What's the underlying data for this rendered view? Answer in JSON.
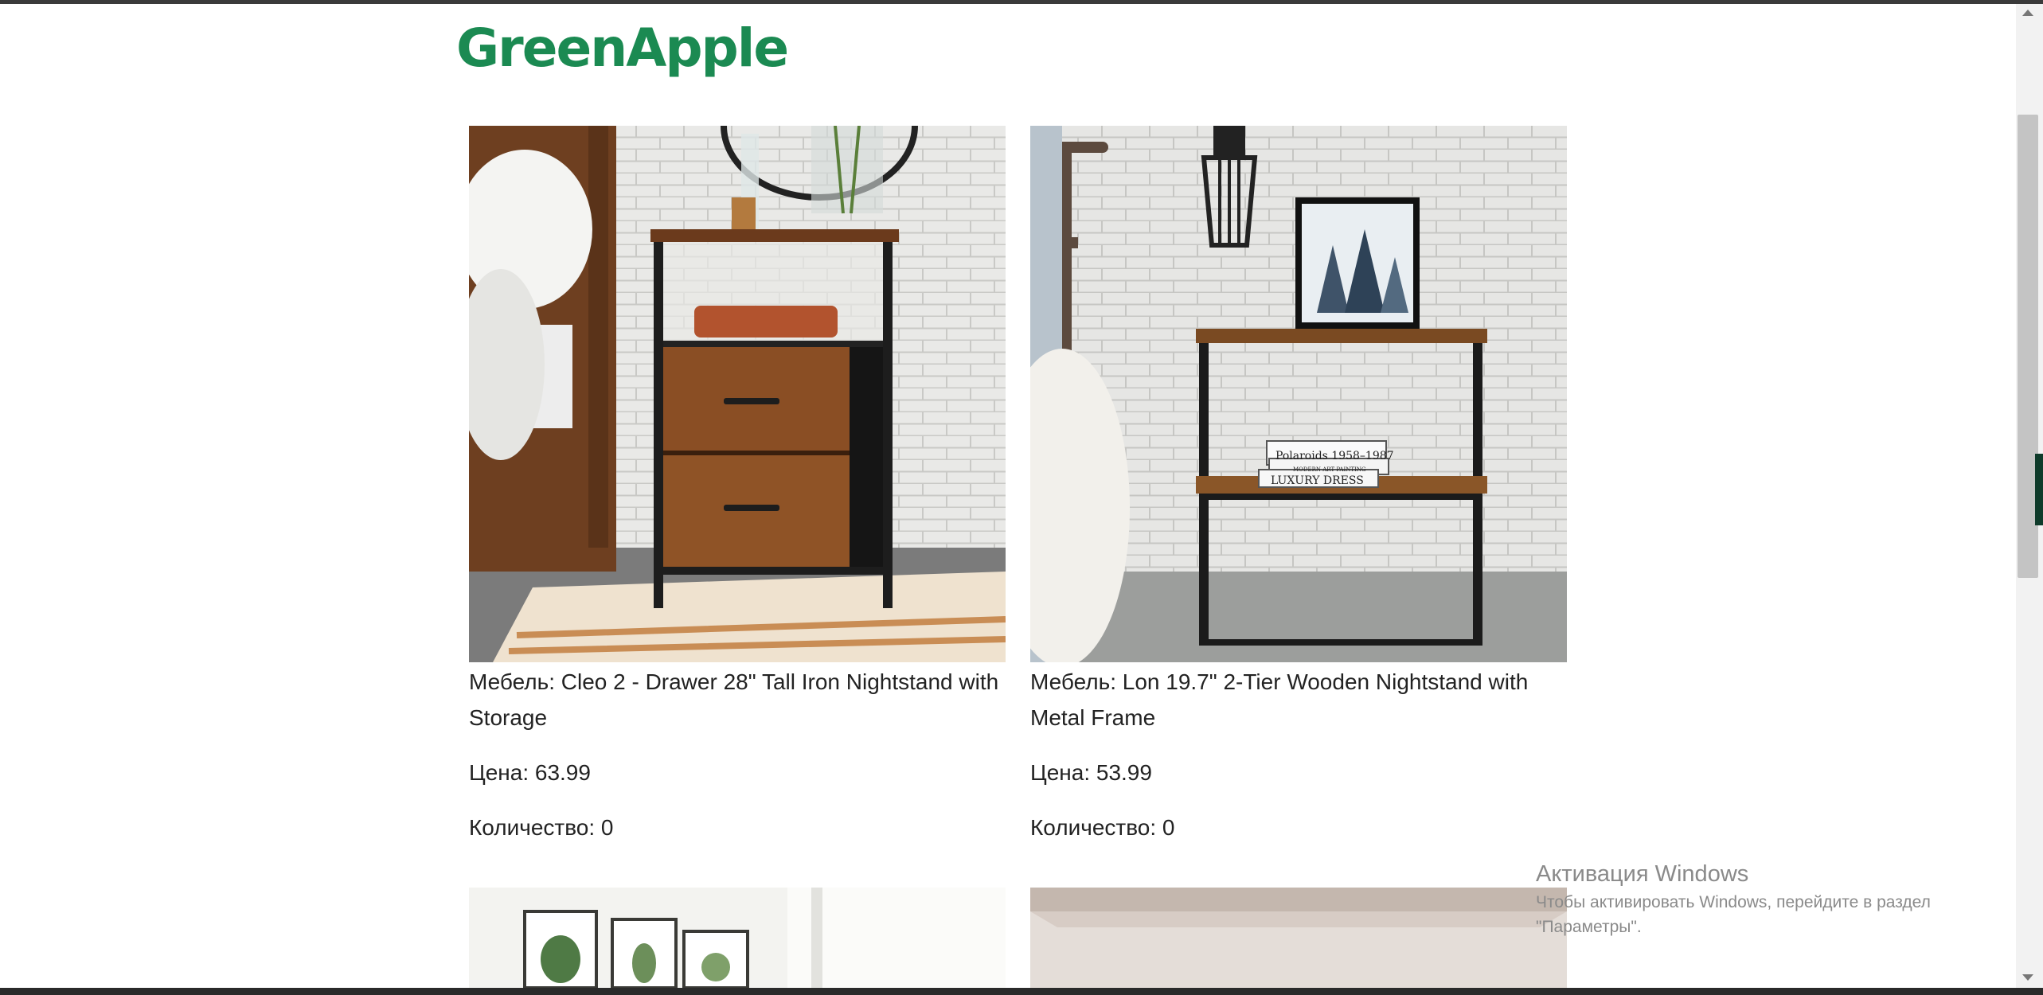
{
  "header": {
    "brand": "GreenApple"
  },
  "products": [
    {
      "name": "Мебель: Cleo 2 - Drawer 28\" Tall Iron Nightstand with Storage",
      "price": "Цена: 63.99",
      "quantity": "Количество: 0",
      "image": "nightstand-two-drawer"
    },
    {
      "name": "Мебель: Lon 19.7\" 2-Tier Wooden Nightstand with Metal Frame",
      "price": "Цена: 53.99",
      "quantity": "Количество: 0",
      "image": "nightstand-two-tier",
      "book_titles": [
        "Polaroids 1958–1987",
        "MODERN ART PAINTING",
        "LUXURY DRESS"
      ]
    },
    {
      "image": "room-with-plant-prints"
    },
    {
      "image": "room-ceiling"
    }
  ],
  "activation": {
    "title": "Активация Windows",
    "text": "Чтобы активировать Windows, перейдите в раздел \"Параметры\"."
  },
  "colors": {
    "brand": "#1b8a52",
    "text": "#222222",
    "watermark": "#8a8a8a"
  }
}
